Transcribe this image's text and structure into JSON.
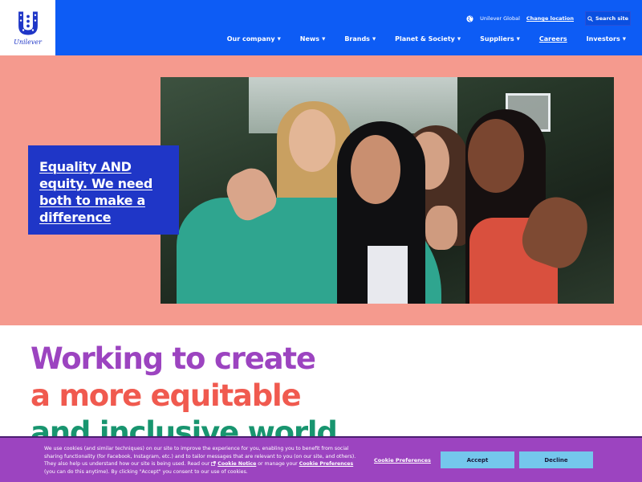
{
  "header": {
    "logo_text": "Unilever",
    "utility": {
      "region_label": "Unilever Global",
      "change_location": "Change location",
      "search_label": "Search site"
    },
    "nav": [
      {
        "label": "Our company",
        "has_dropdown": true
      },
      {
        "label": "News",
        "has_dropdown": true
      },
      {
        "label": "Brands",
        "has_dropdown": true
      },
      {
        "label": "Planet & Society",
        "has_dropdown": true
      },
      {
        "label": "Suppliers",
        "has_dropdown": true
      },
      {
        "label": "Careers",
        "has_dropdown": false
      },
      {
        "label": "Investors",
        "has_dropdown": true
      }
    ]
  },
  "hero": {
    "callout": "Equality AND equity. We need both to make a difference"
  },
  "headline": {
    "line1": "Working to create",
    "line2": "a more equitable",
    "line3": "and inclusive world"
  },
  "cookie_banner": {
    "text_before_notice": "We use cookies (and similar techniques) on our site to improve the experience for you, enabling you to benefit from social sharing functionality (for Facebook, Instagram, etc.) and to tailor messages that are relevant to you (on our site, and others). They also help us understand how our site is being used. Read our ",
    "notice_link": "Cookie Notice",
    "text_middle": " or manage your ",
    "prefs_link": "Cookie Preferences",
    "text_after": " (you can do this anytime). By clicking \"Accept\" you consent to our use of cookies.",
    "preferences_button": "Cookie Preferences",
    "accept_button": "Accept",
    "decline_button": "Decline"
  },
  "colors": {
    "brand_blue": "#0d5cf5",
    "callout_blue": "#1f36c7",
    "hero_salmon": "#f59a8e",
    "headline_purple": "#9c44c0",
    "headline_coral": "#f05a4f",
    "headline_green": "#18956f",
    "button_light_blue": "#74c7ec"
  },
  "icons": [
    "unilever-logo-icon",
    "globe-icon",
    "search-icon",
    "chevron-down-icon",
    "external-link-icon"
  ]
}
